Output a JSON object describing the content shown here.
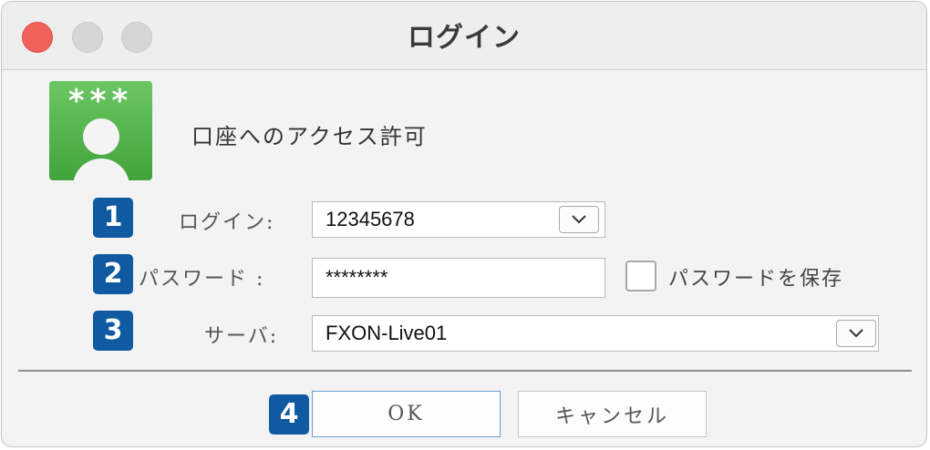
{
  "window": {
    "title": "ログイン"
  },
  "logo": {
    "stars": "***"
  },
  "header": {
    "access_text": "口座へのアクセス許可"
  },
  "badges": [
    "1",
    "2",
    "3",
    "4"
  ],
  "login": {
    "label": "ログイン:",
    "value": "12345678"
  },
  "password": {
    "label": "パスワード :",
    "value": "********",
    "save_label": "パスワードを保存",
    "save_checked": false
  },
  "server": {
    "label": "サーバ:",
    "value": "FXON-Live01"
  },
  "buttons": {
    "ok": "OK",
    "cancel": "キャンセル"
  },
  "colors": {
    "badge": "#0f5aa0",
    "close": "#f0625b",
    "logo": "#4caf50",
    "ok_border": "#6a9fd6"
  }
}
